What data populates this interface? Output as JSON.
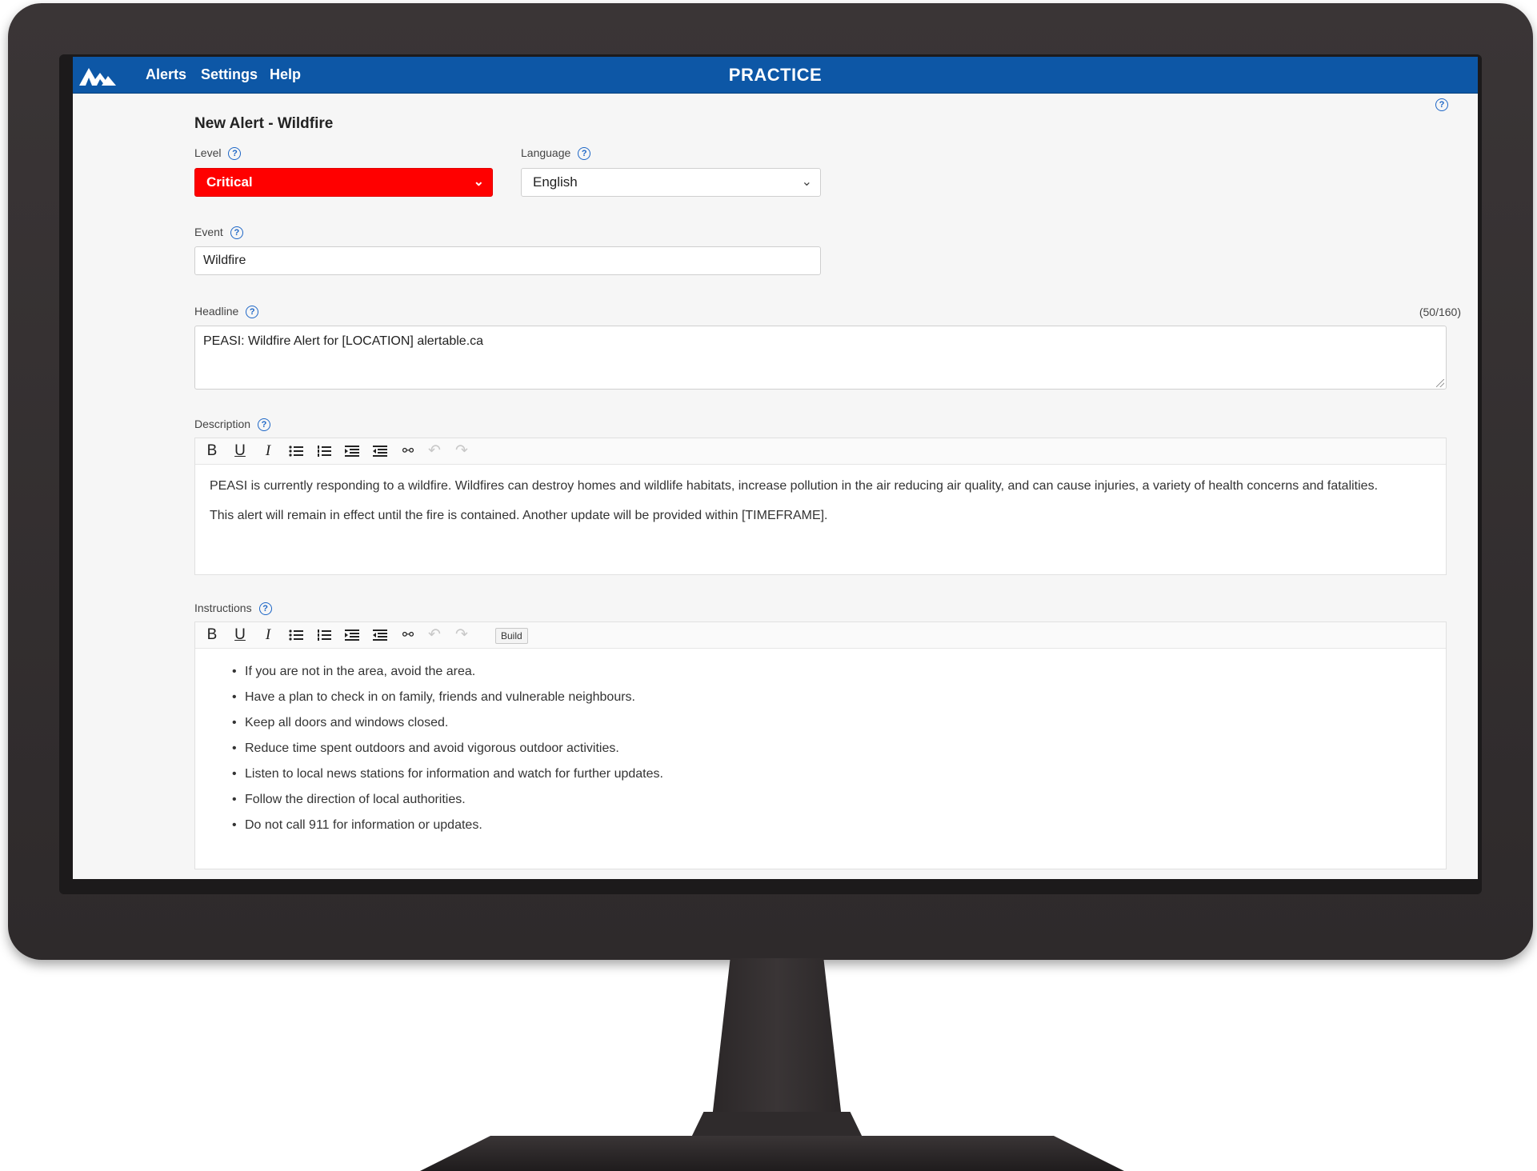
{
  "nav": {
    "items": [
      "Alerts",
      "Settings",
      "Help"
    ],
    "mode_label": "PRACTICE"
  },
  "form": {
    "title": "New Alert - Wildfire",
    "level": {
      "label": "Level",
      "value": "Critical",
      "color": "#ff0000"
    },
    "language": {
      "label": "Language",
      "value": "English"
    },
    "event": {
      "label": "Event",
      "value": "Wildfire"
    },
    "headline": {
      "label": "Headline",
      "counter": "(50/160)",
      "value": "PEASI: Wildfire Alert for [LOCATION]  alertable.ca"
    },
    "description": {
      "label": "Description",
      "paragraphs": [
        "PEASI is currently responding to a wildfire. Wildfires can destroy homes and wildlife habitats, increase pollution in the air reducing air quality, and can cause injuries, a variety of health concerns and fatalities.",
        "This alert will remain in effect until the fire is contained. Another update will be provided within [TIMEFRAME]."
      ]
    },
    "instructions": {
      "label": "Instructions",
      "build_label": "Build",
      "items": [
        "If you are not in the area, avoid the area.",
        "Have a plan to check in on family, friends and vulnerable neighbours.",
        "Keep all doors and windows closed.",
        "Reduce time spent outdoors and avoid vigorous outdoor activities.",
        "Listen to local news stations for information and watch for further updates.",
        "Follow the direction of local authorities.",
        "Do not call 911 for information or updates."
      ]
    }
  },
  "icons": {
    "help": "question-circle",
    "toolbar": [
      "bold",
      "underline",
      "italic",
      "bullet-list",
      "numbered-list",
      "indent",
      "outdent",
      "unlink",
      "undo",
      "redo"
    ]
  },
  "colors": {
    "topbar": "#0d57a6",
    "critical": "#ff0000",
    "help_icon": "#1d66c6"
  }
}
